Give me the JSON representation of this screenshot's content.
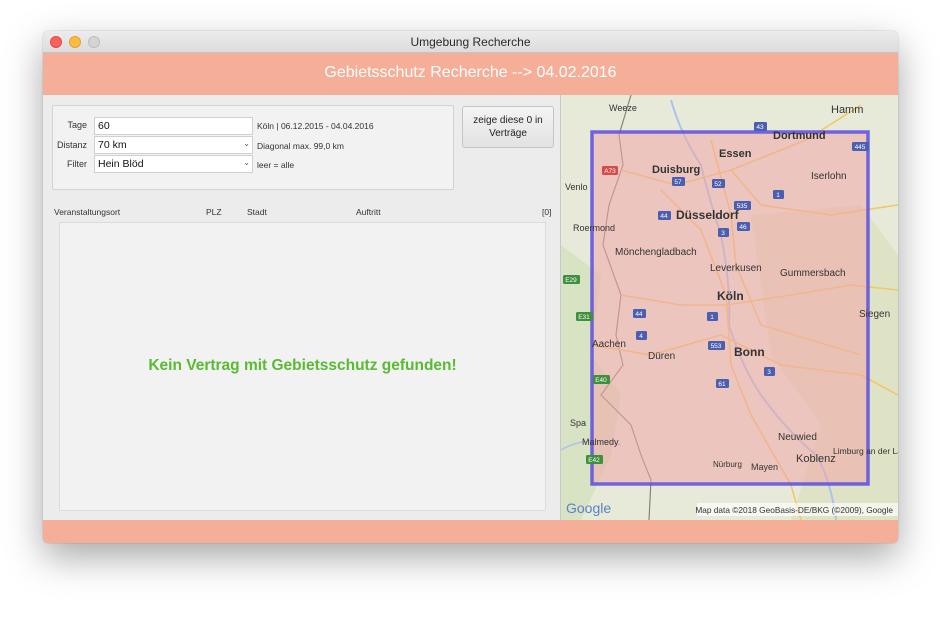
{
  "window": {
    "title": "Umgebung Recherche"
  },
  "header": {
    "title": "Gebietsschutz Recherche --> 04.02.2016"
  },
  "filters": {
    "tage": {
      "label": "Tage",
      "value": "60",
      "hint": "Köln | 06.12.2015 - 04.04.2016"
    },
    "distanz": {
      "label": "Distanz",
      "value": "70 km",
      "hint": "Diagonal max. 99,0 km"
    },
    "filter": {
      "label": "Filter",
      "value": "Hein Blöd",
      "hint": "leer = alle"
    }
  },
  "show_button": {
    "line1": "zeige diese 0 in",
    "line2": "Verträge"
  },
  "table": {
    "columns": [
      "Veranstaltungsort",
      "PLZ",
      "Stadt",
      "Auftritt"
    ],
    "count": "[0]",
    "empty_message": "Kein Vertrag mit Gebietsschutz gefunden!"
  },
  "map": {
    "cities": [
      "Weeze",
      "Hamm",
      "Dortmund",
      "Essen",
      "Duisburg",
      "Venlo",
      "Iserlohn",
      "Düsseldorf",
      "Roermond",
      "Mönchengladbach",
      "Leverkusen",
      "Gummersbach",
      "Köln",
      "Siegen",
      "Aachen",
      "Düren",
      "Bonn",
      "Spa",
      "Malmedy",
      "Neuwied",
      "Koblenz",
      "Limburg an der Lahn",
      "Nürburg",
      "Mayen"
    ],
    "road_shields": [
      "A73",
      "57",
      "52",
      "1",
      "44",
      "535",
      "3",
      "46",
      "43",
      "445",
      "E29",
      "E31",
      "44",
      "4",
      "1",
      "553",
      "61",
      "3",
      "E40",
      "E42"
    ],
    "logo": "Google",
    "attribution": "Map data ©2018 GeoBasis-DE/BKG (©2009), Google",
    "region_fill": "#f0a8a8",
    "region_border": "#5a4ee0"
  }
}
